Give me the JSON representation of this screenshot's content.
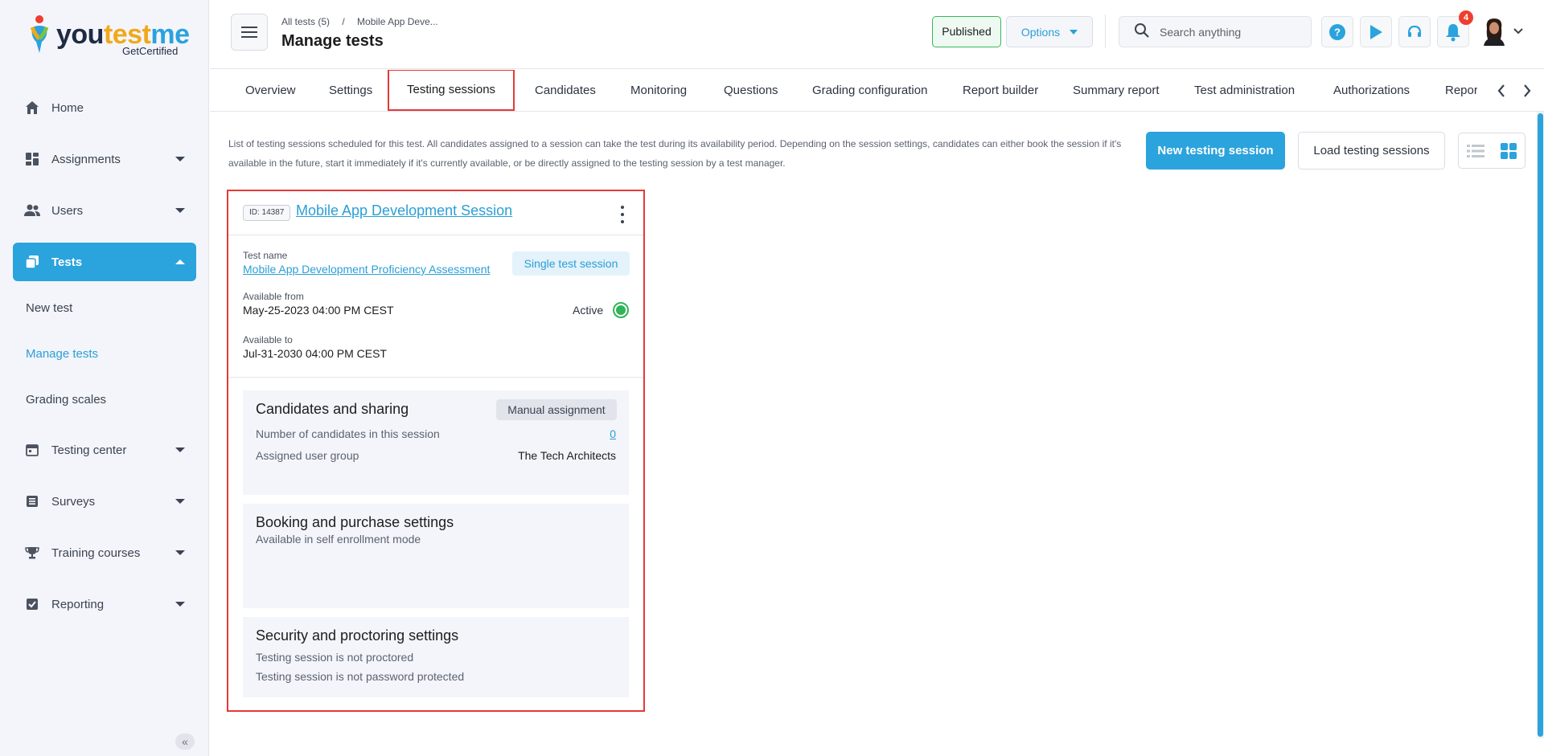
{
  "logo": {
    "word_a": "you",
    "word_b": "test",
    "word_c": "me",
    "tagline": "GetCertified"
  },
  "sidebar": {
    "items": [
      {
        "label": "Home",
        "icon": "home-icon"
      },
      {
        "label": "Assignments",
        "icon": "dashboard-icon"
      },
      {
        "label": "Users",
        "icon": "users-icon"
      },
      {
        "label": "Tests",
        "icon": "copy-icon"
      },
      {
        "label": "Testing center",
        "icon": "calendar-icon"
      },
      {
        "label": "Surveys",
        "icon": "list-icon"
      },
      {
        "label": "Training courses",
        "icon": "trophy-icon"
      },
      {
        "label": "Reporting",
        "icon": "report-icon"
      }
    ],
    "sub_items": [
      "New test",
      "Manage tests",
      "Grading scales"
    ],
    "collapse_label": "«"
  },
  "header": {
    "breadcrumb": [
      "All tests (5)",
      "/",
      "Mobile App Deve..."
    ],
    "title": "Manage tests",
    "published_label": "Published",
    "options_label": "Options",
    "search_placeholder": "Search anything",
    "notification_count": "4"
  },
  "tabs": [
    "Overview",
    "Settings",
    "Testing sessions",
    "Candidates",
    "Monitoring",
    "Questions",
    "Grading configuration",
    "Report builder",
    "Summary report",
    "Test administration",
    "Authorizations",
    "Repor"
  ],
  "content": {
    "description": "List of testing sessions scheduled for this test. All candidates assigned to a session can take the test during its availability period. Depending on the session settings, candidates can either book the session if it's available in the future, start it immediately if it's currently available, or be directly assigned to the testing session by a test manager.",
    "new_session_label": "New testing session",
    "load_sessions_label": "Load testing sessions"
  },
  "session": {
    "id_label": "ID: 14387",
    "title": "Mobile App Development Session",
    "test_name_label": "Test name",
    "test_name": "Mobile App Development Proficiency Assessment",
    "session_type": "Single test session",
    "available_from_label": "Available from",
    "available_from": "May-25-2023 04:00 PM CEST",
    "status": "Active",
    "available_to_label": "Available to",
    "available_to": "Jul-31-2030 04:00 PM CEST",
    "candidates_section": {
      "title": "Candidates and sharing",
      "badge": "Manual assignment",
      "count_label": "Number of candidates in this session",
      "count": "0",
      "group_label": "Assigned user group",
      "group": "The Tech Architects"
    },
    "booking_section": {
      "title": "Booking and purchase settings",
      "line1": "Available in self enrollment mode"
    },
    "security_section": {
      "title": "Security and proctoring settings",
      "line1": "Testing session is not proctored",
      "line2": "Testing session is not password protected"
    }
  },
  "colors": {
    "accent": "#2ba3dc",
    "highlight": "#e53935",
    "active_status": "#2fb457",
    "badge": "#ef3d2e"
  }
}
